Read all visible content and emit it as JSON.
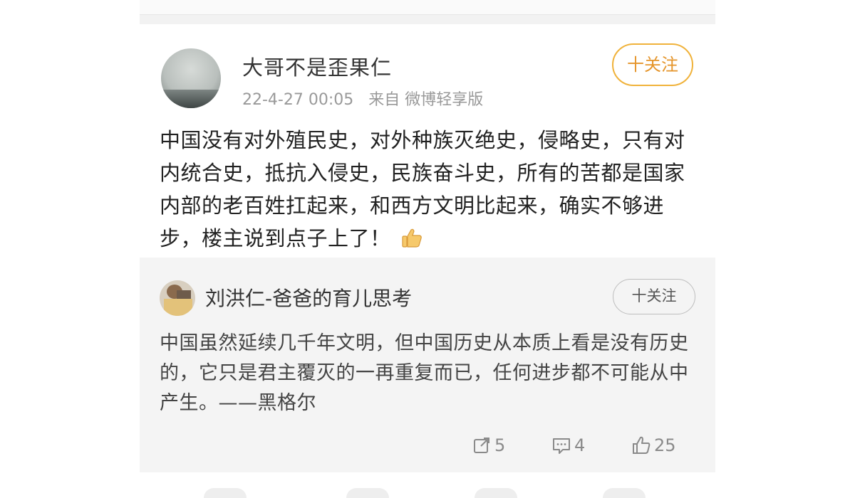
{
  "post": {
    "username": "大哥不是歪果仁",
    "timestamp": "22-4-27 00:05",
    "source": "来自 微博轻享版",
    "follow_label": "十关注",
    "text": "中国没有对外殖民史，对外种族灭绝史，侵略史，只有对内统合史，抵抗入侵史，民族奋斗史，所有的苦都是国家内部的老百姓扛起来，和西方文明比起来，确实不够进步，楼主说到点子上了！",
    "emoji": "thumbs-up-icon"
  },
  "repost": {
    "username": "刘洪仁-爸爸的育儿思考",
    "follow_label": "十关注",
    "text": "中国虽然延续几千年文明，但中国历史从本质上看是没有历史的，它只是君主覆灭的一再重复而已，任何进步都不可能从中产生。——黑格尔",
    "actions": {
      "repost_count": "5",
      "comment_count": "4",
      "like_count": "25"
    }
  },
  "colors": {
    "follow_accent": "#e5952b",
    "follow_border": "#f0b23a",
    "repost_bg": "#f4f4f4"
  }
}
